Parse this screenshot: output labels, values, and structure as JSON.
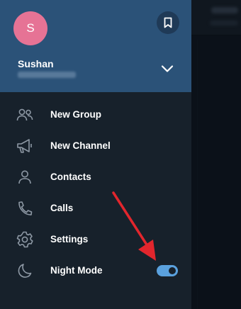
{
  "profile": {
    "avatar_initial": "S",
    "name": "Sushan",
    "avatar_color": "#e67395"
  },
  "menu": [
    {
      "label": "New Group",
      "icon": "people-icon"
    },
    {
      "label": "New Channel",
      "icon": "megaphone-icon"
    },
    {
      "label": "Contacts",
      "icon": "person-icon"
    },
    {
      "label": "Calls",
      "icon": "phone-icon"
    },
    {
      "label": "Settings",
      "icon": "gear-icon"
    },
    {
      "label": "Night Mode",
      "icon": "moon-icon"
    }
  ],
  "night_mode": {
    "enabled": true
  },
  "colors": {
    "header": "#2b5278",
    "drawer": "#17212b",
    "accent": "#5aa1de",
    "annotation_arrow": "#e2262d"
  }
}
